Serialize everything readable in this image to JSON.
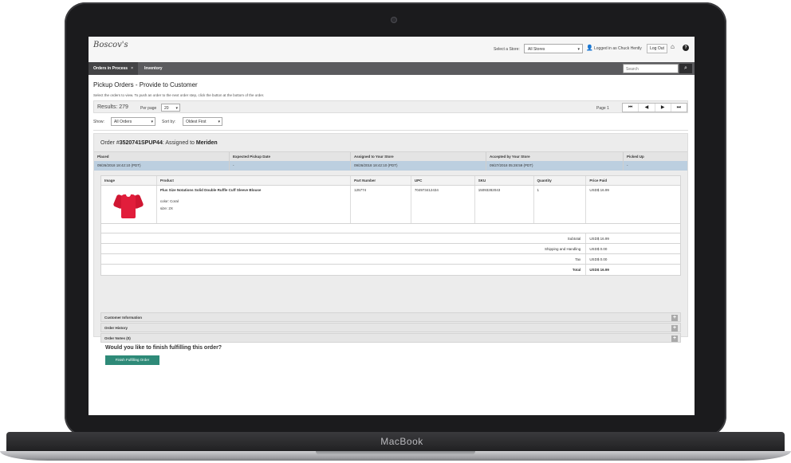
{
  "device": {
    "brand": "MacBook"
  },
  "header": {
    "logo": "Boscov's",
    "store_label": "Select a Store:",
    "store_value": "All Stores",
    "logged_in": "Logged in as Chuck Hently",
    "logout_label": "Log Out",
    "icons": {
      "user": "user-icon",
      "home": "home-icon",
      "help": "help-icon"
    }
  },
  "nav": {
    "tabs": [
      {
        "label": "Orders in Process"
      },
      {
        "label": "Inventory"
      }
    ],
    "search_placeholder": "Search"
  },
  "page": {
    "title": "Pickup Orders - Provide to Customer",
    "instructions": "Select the orders to view. To push an order to the next order step, click the button at the bottom of the order."
  },
  "results": {
    "label": "Results: 279",
    "per_page_label": "Per page",
    "per_page_value": "20",
    "page_label": "Page 1",
    "pager": [
      "⏮",
      "◀",
      "▶",
      "⏭"
    ]
  },
  "filters": {
    "show_label": "Show:",
    "show_value": "All Orders",
    "sort_label": "Sort by:",
    "sort_value": "Oldest First"
  },
  "order": {
    "prefix": "Order #",
    "number": "3520741SPUP44",
    "assigned_text": ": Assigned to ",
    "store": "Meriden",
    "info_headers": [
      "Placed",
      "Expected Pickup Date",
      "Assigned to Your Store",
      "Accepted by Your Store",
      "Picked Up"
    ],
    "info_values": [
      "09/26/2018 18:42:10 (PDT)",
      "-",
      "09/26/2018 18:42:10 (PDT)",
      "09/27/2018 05:28:59 (PDT)",
      "-"
    ],
    "item_headers": [
      "Image",
      "Product",
      "Part Number",
      "UPC",
      "SKU",
      "Quantity",
      "Price Paid"
    ],
    "item": {
      "product": "Plus Size Notations Solid Double Ruffle Cuff Sleeve Blouse",
      "color": "color: Coral",
      "size": "size: 2X",
      "part_number": "125774",
      "upc": "704973412434",
      "sku": "15093282043",
      "quantity": "1",
      "price": "USD$ 16.99"
    },
    "totals": [
      {
        "label": "Subtotal",
        "value": "USD$ 16.99"
      },
      {
        "label": "Shipping and Handling",
        "value": "USD$ 0.00"
      },
      {
        "label": "Tax",
        "value": "USD$ 0.00"
      },
      {
        "label": "Total",
        "value": "USD$ 16.99"
      }
    ],
    "sections": [
      "Customer Information",
      "Order History",
      "Order Notes (0)"
    ],
    "finish_question": "Would you like to finish fulfilling this order?",
    "finish_button": "Finish Fulfilling Order"
  }
}
